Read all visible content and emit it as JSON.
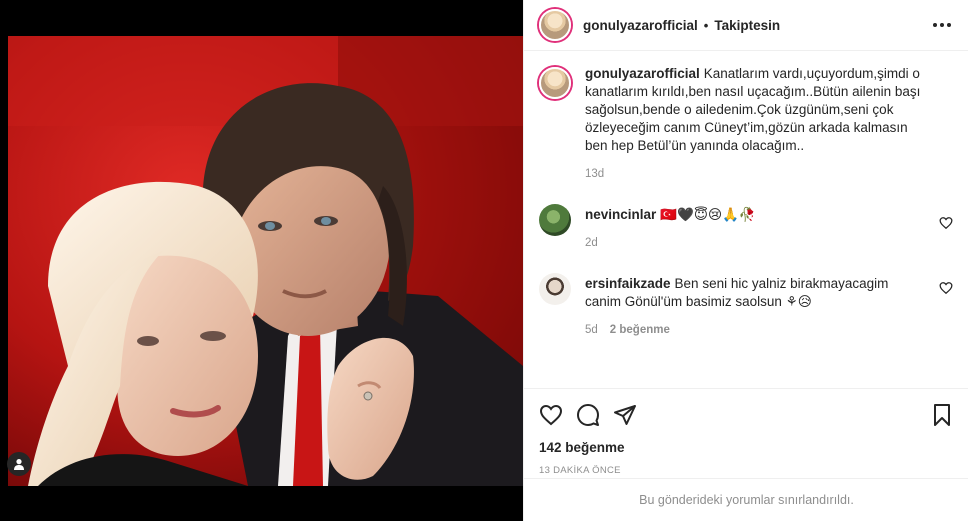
{
  "post": {
    "username": "gonulyazarofficial",
    "separator": "•",
    "follow_status": "Takiptesin"
  },
  "caption": {
    "username": "gonulyazarofficial",
    "text": "Kanatlarım vardı,uçuyordum,şimdi o kanatlarım kırıldı,ben nasıl uçacağım..Bütün ailenin başı sağolsun,bende o ailedenim.Çok üzgünüm,seni çok özleyeceğim canım Cüneyt’im,gözün arkada kalmasın ben hep Betül’ün yanında olacağım..",
    "age": "13d"
  },
  "comments": [
    {
      "username": "nevincinlar",
      "text": "🇹🇷🖤😇😢🙏🥀",
      "age": "2d",
      "likes": ""
    },
    {
      "username": "ersinfaikzade",
      "text": "Ben seni hic yalniz birakmayacagim canim Gönül'üm basimiz saolsun ⚘😥",
      "age": "5d",
      "likes": "2 beğenme"
    }
  ],
  "stats": {
    "likes": "142 beğenme",
    "posted": "13 DAKİKA ÖNCE"
  },
  "footer": {
    "notice": "Bu gönderideki yorumlar sınırlandırıldı."
  },
  "colors": {
    "story_ring": "#e0307a",
    "secondary_text": "#8e8e8e",
    "divider": "#efefef"
  }
}
